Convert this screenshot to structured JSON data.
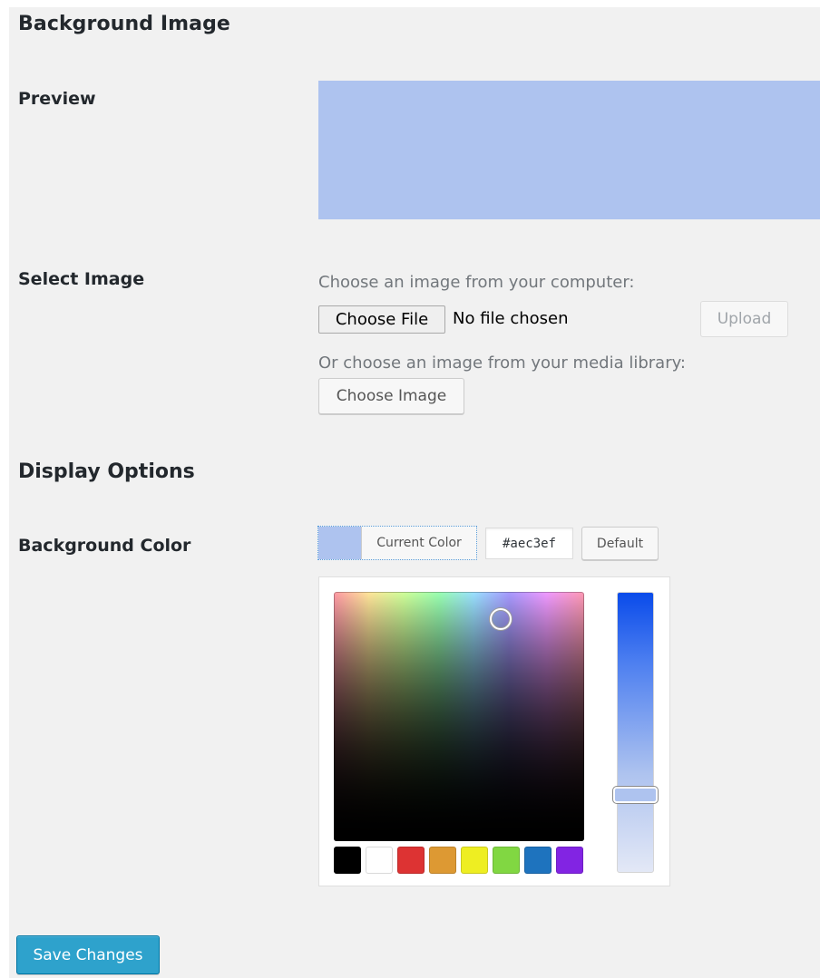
{
  "section_background": {
    "title": "Background Image",
    "preview_label": "Preview",
    "select_label": "Select Image",
    "computer_hint": "Choose an image from your computer:",
    "choose_file_label": "Choose File",
    "no_file_text": "No file chosen",
    "upload_label": "Upload",
    "library_hint": "Or choose an image from your media library:",
    "choose_image_label": "Choose Image"
  },
  "section_display": {
    "title": "Display Options",
    "bg_color_label": "Background Color",
    "current_color_label": "Current Color",
    "hex_value": "#aec3ef",
    "default_label": "Default"
  },
  "colors": {
    "current": "#aec3ef",
    "palette": [
      "#000000",
      "#ffffff",
      "#dd3333",
      "#dd9933",
      "#eeee22",
      "#81d742",
      "#1e73be",
      "#8224e3"
    ],
    "primary_button": "#2ea2cc"
  },
  "icons": {
    "picker_handle": "circle-handle-icon",
    "slider_handle": "slider-handle-icon"
  },
  "actions": {
    "save_label": "Save Changes"
  }
}
